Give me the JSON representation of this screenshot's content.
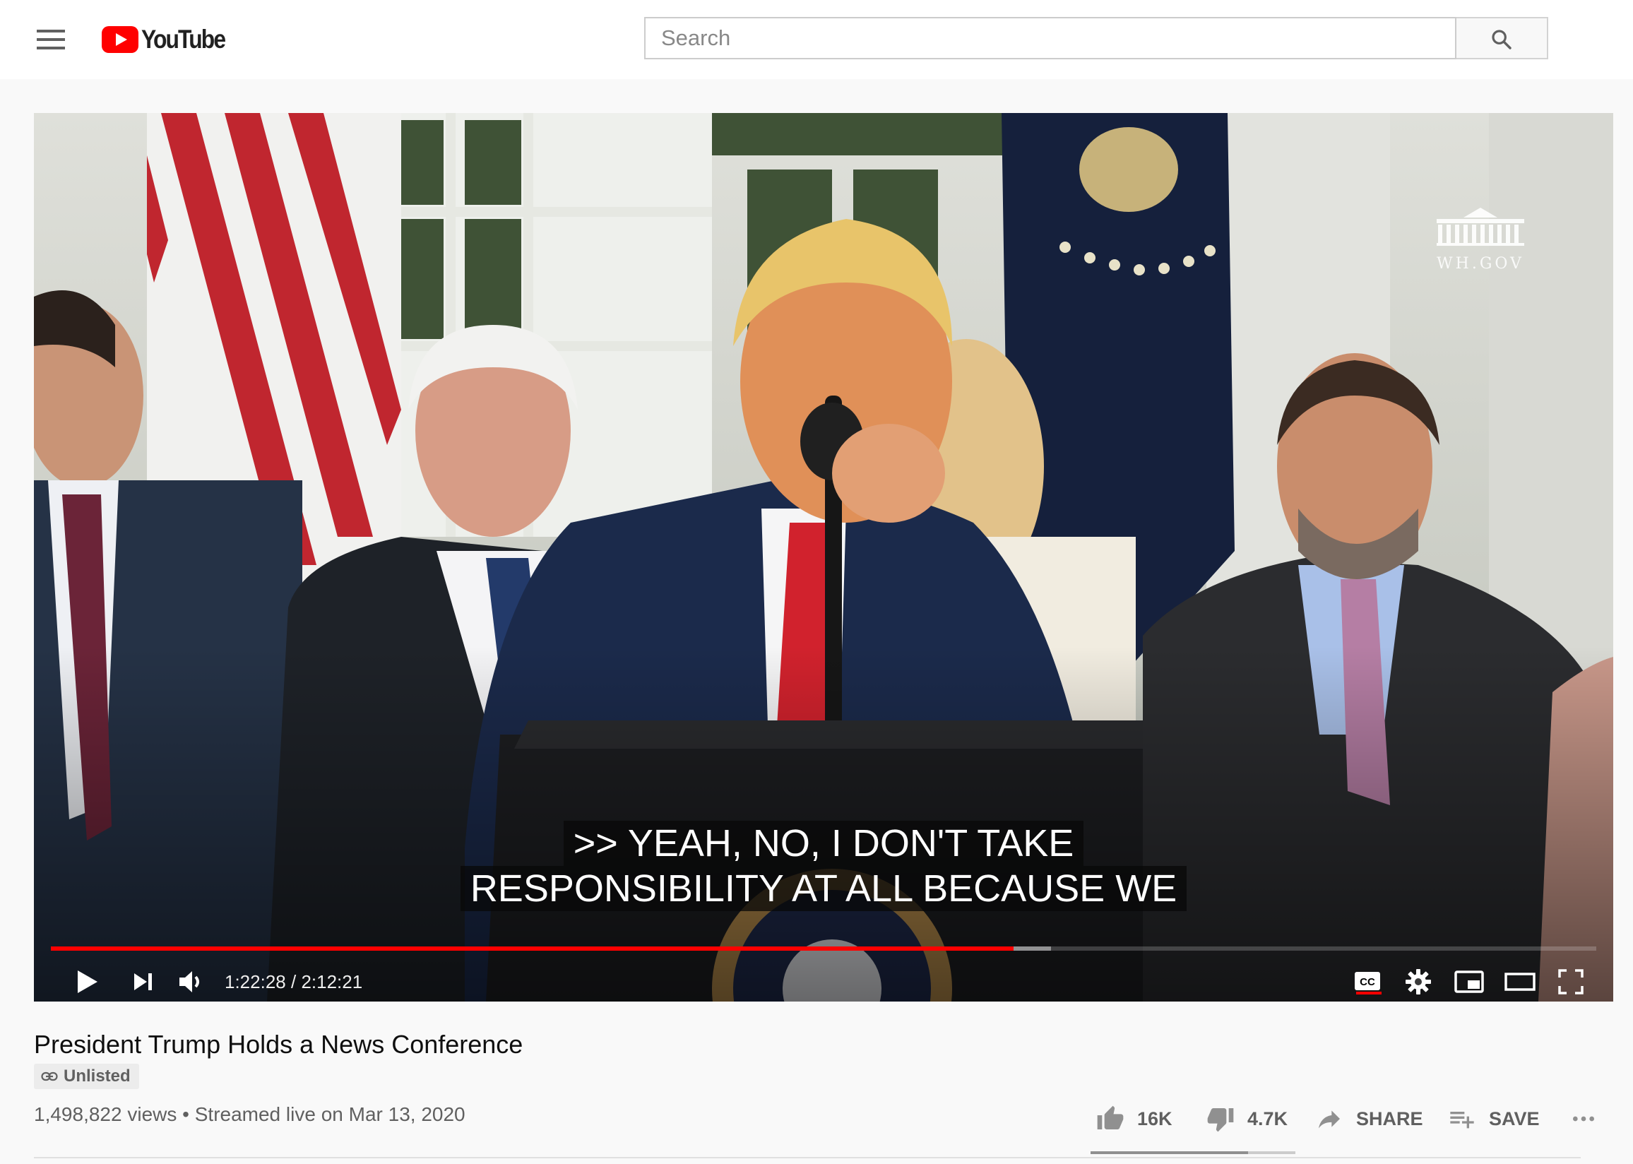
{
  "app": {
    "logo_text": "YouTube",
    "search": {
      "placeholder": "Search",
      "value": ""
    }
  },
  "player": {
    "watermark": "WH.GOV",
    "captions": [
      ">> YEAH, NO, I DON'T TAKE",
      "RESPONSIBILITY AT ALL BECAUSE WE"
    ],
    "time": {
      "current": "1:22:28",
      "duration": "2:12:21"
    },
    "progress": {
      "played_fraction": 0.623,
      "buffered_fraction": 0.647
    },
    "controls": [
      "play-icon",
      "next-icon",
      "volume-icon",
      "cc-icon",
      "settings-icon",
      "miniplayer-icon",
      "theater-icon",
      "fullscreen-icon"
    ],
    "accent_color": "#ff0000"
  },
  "video": {
    "title": "President Trump Holds a News Conference",
    "privacy_badge": "Unlisted",
    "views": "1,498,822 views",
    "date": "Streamed live on Mar 13, 2020",
    "separator": "•",
    "actions": {
      "like_count": "16K",
      "dislike_count": "4.7K",
      "share_label": "SHARE",
      "save_label": "SAVE"
    },
    "like_ratio": 0.77
  }
}
